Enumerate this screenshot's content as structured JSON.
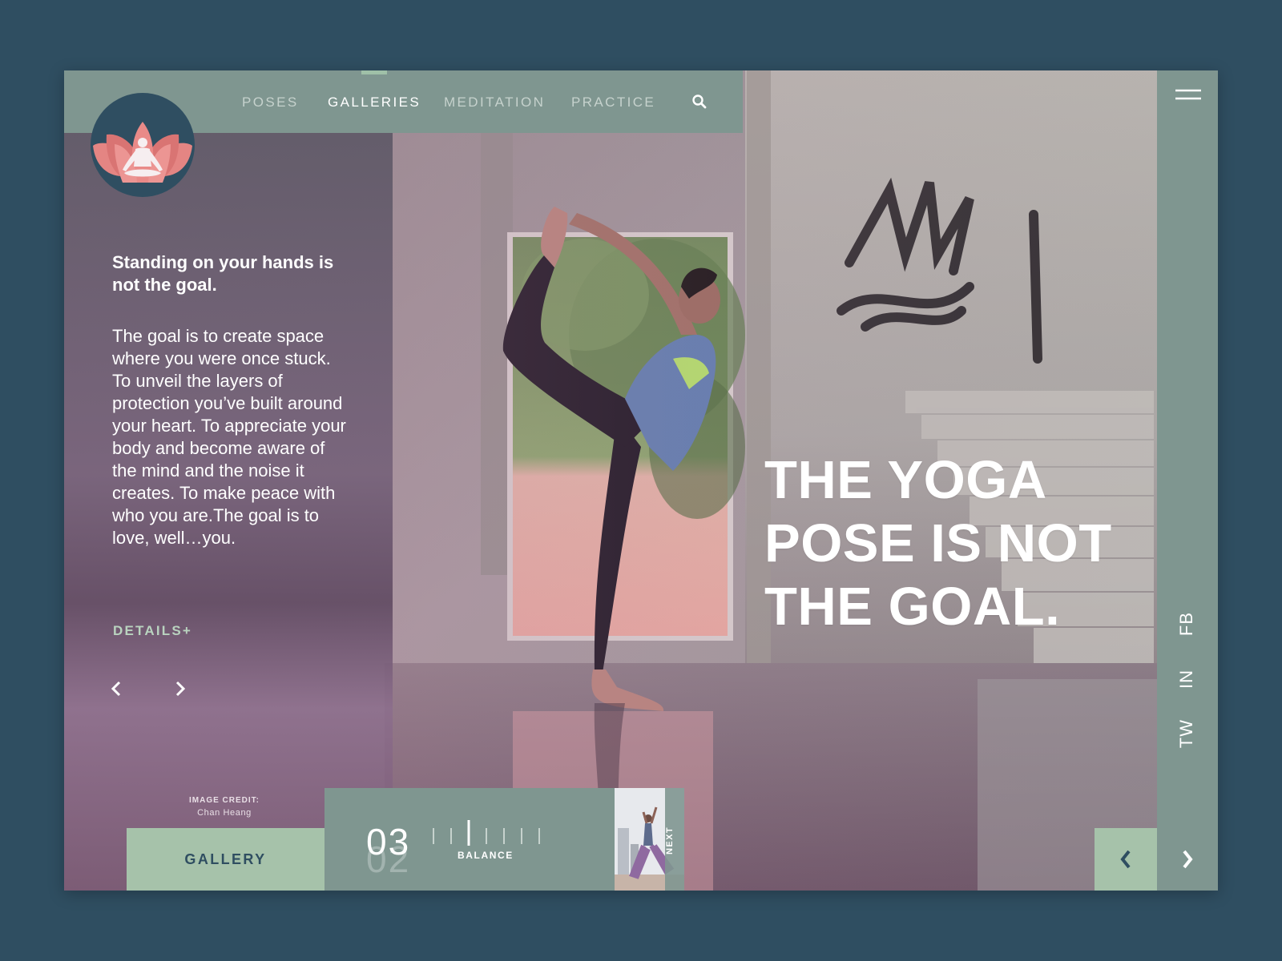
{
  "nav": {
    "items": [
      {
        "label": "POSES",
        "active": false
      },
      {
        "label": "GALLERIES",
        "active": true
      },
      {
        "label": "MEDITATION",
        "active": false
      },
      {
        "label": "PRACTICE",
        "active": false
      }
    ],
    "search_icon": "search-icon"
  },
  "logo": {
    "icon": "lotus-meditation-icon"
  },
  "left": {
    "headline": "Standing on your hands is not the goal.",
    "body": "The goal is to create space where you were once stuck. To unveil the layers of protection you’ve built around your heart. To appreciate your body and become aware of the mind and the noise it creates. To make peace with who you are.The goal is to love, well…you.",
    "details_label": "DETAILS+",
    "prev_icon": "chevron-left-icon",
    "next_icon": "chevron-right-icon"
  },
  "credit": {
    "label": "IMAGE CREDIT:",
    "name": "Chan Heang"
  },
  "bottom": {
    "gallery_label": "GALLERY",
    "counter_current": "03",
    "counter_previous": "02",
    "pose_name": "BALANCE",
    "next_label": "NEXT",
    "prev_icon": "chevron-left-icon",
    "next_icon": "chevron-right-icon"
  },
  "hero": {
    "title": "THE YOGA POSE IS NOT THE GOAL."
  },
  "sidebar": {
    "menu_icon": "menu-icon",
    "social": [
      "FB",
      "IN",
      "TW"
    ]
  },
  "colors": {
    "background": "#2f4e61",
    "nav_bar": "#7f9690",
    "accent_green": "#a6c2aa",
    "logo_pink": "#e48583"
  }
}
